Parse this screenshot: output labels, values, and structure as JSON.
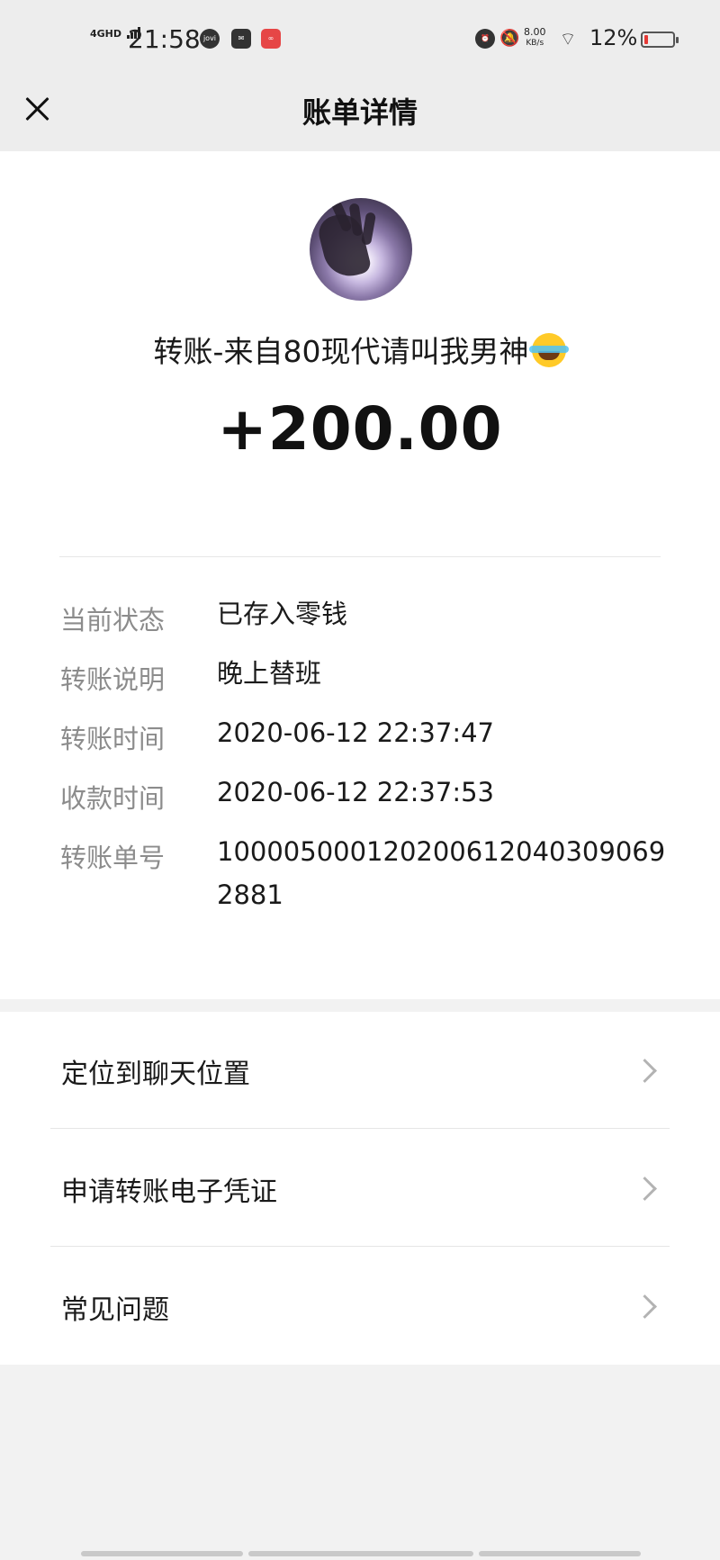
{
  "status_bar": {
    "network": "4GHD",
    "time": "21:58",
    "app_icons": [
      "jovi-icon",
      "message-icon",
      "app-badge-icon"
    ],
    "speed_value": "8.00",
    "speed_unit": "KB/s",
    "battery_percent": "12%",
    "battery_level": 0.12,
    "battery_color": "#e53935"
  },
  "nav": {
    "title": "账单详情",
    "close_icon": "close-icon"
  },
  "transfer": {
    "avatar": "avatar-image",
    "payer_line": "转账-来自80现代请叫我男神",
    "emoji": "laughing-tears-emoji",
    "amount": "+200.00"
  },
  "details": [
    {
      "label": "当前状态",
      "value": "已存入零钱"
    },
    {
      "label": "转账说明",
      "value": "晚上替班"
    },
    {
      "label": "转账时间",
      "value": "2020-06-12 22:37:47"
    },
    {
      "label": "收款时间",
      "value": "2020-06-12 22:37:53"
    },
    {
      "label": "转账单号",
      "value": "1000050001202006120403090692881"
    }
  ],
  "menu": [
    {
      "label": "定位到聊天位置"
    },
    {
      "label": "申请转账电子凭证"
    },
    {
      "label": "常见问题"
    }
  ]
}
